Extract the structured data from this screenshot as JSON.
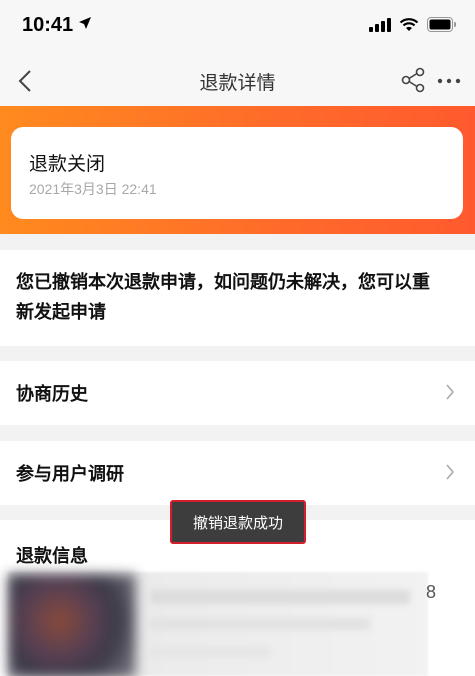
{
  "status_bar": {
    "time": "10:41"
  },
  "nav": {
    "title": "退款详情"
  },
  "status_card": {
    "title": "退款关闭",
    "time": "2021年3月3日 22:41"
  },
  "notice": {
    "text": "您已撤销本次退款申请，如问题仍未解决，您可以重新发起申请"
  },
  "rows": {
    "history_label": "协商历史",
    "research_label": "参与用户调研"
  },
  "refund_info": {
    "title": "退款信息",
    "partial_text": "8"
  },
  "toast": {
    "text": "撤销退款成功"
  },
  "icons": {
    "back": "chevron-left-icon",
    "share": "share-icon",
    "more": "more-icon",
    "row_chevron": "chevron-right-icon"
  },
  "colors": {
    "banner_start": "#ff8a1e",
    "banner_end": "#ff5a2e",
    "toast_bg": "#3d3d3d",
    "toast_border": "#d11f2b"
  }
}
